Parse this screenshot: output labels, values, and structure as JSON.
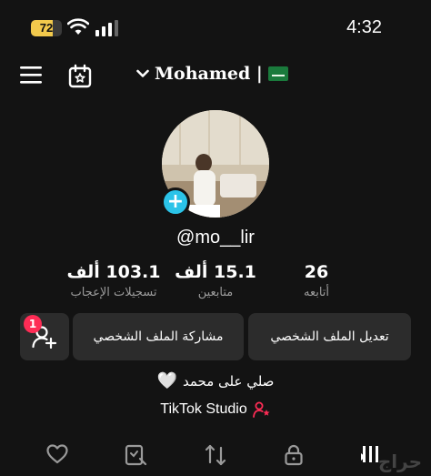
{
  "status_bar": {
    "battery_level": "72",
    "battery_fraction": 0.72,
    "time": "4:32",
    "battery_color": "#f2c94c"
  },
  "top_nav": {
    "account_name": "Mohamed |",
    "flag_icon": "saudi-flag",
    "icons": [
      "menu-icon",
      "calendar-star-icon",
      "chevron-down-icon"
    ]
  },
  "profile": {
    "username": "@mo__lir",
    "add_avatar_symbol": "+",
    "stats": {
      "likes_value": "103.1 ألف",
      "likes_label": "تسجيلات الإعجاب",
      "followers_value": "15.1 ألف",
      "followers_label": "متابعين",
      "following_value": "26",
      "following_label": "أتابعه"
    }
  },
  "actions": {
    "edit_label": "تعديل الملف الشخصي",
    "share_label": "مشاركة الملف الشخصي",
    "friend_requests_badge": "1"
  },
  "bio": {
    "text": "صلي على محمد",
    "heart_emoji": "🤍"
  },
  "studio": {
    "label": "TikTok Studio"
  },
  "tabs": [
    "liked-heart-icon",
    "favorites-icon",
    "reposts-icon",
    "private-lock-icon",
    "videos-grid-icon"
  ],
  "watermark": "حراج",
  "colors": {
    "background": "#131313",
    "button_bg": "#2c2c2c",
    "accent_red": "#fe2c55",
    "accent_cyan": "#2bc3e8"
  }
}
